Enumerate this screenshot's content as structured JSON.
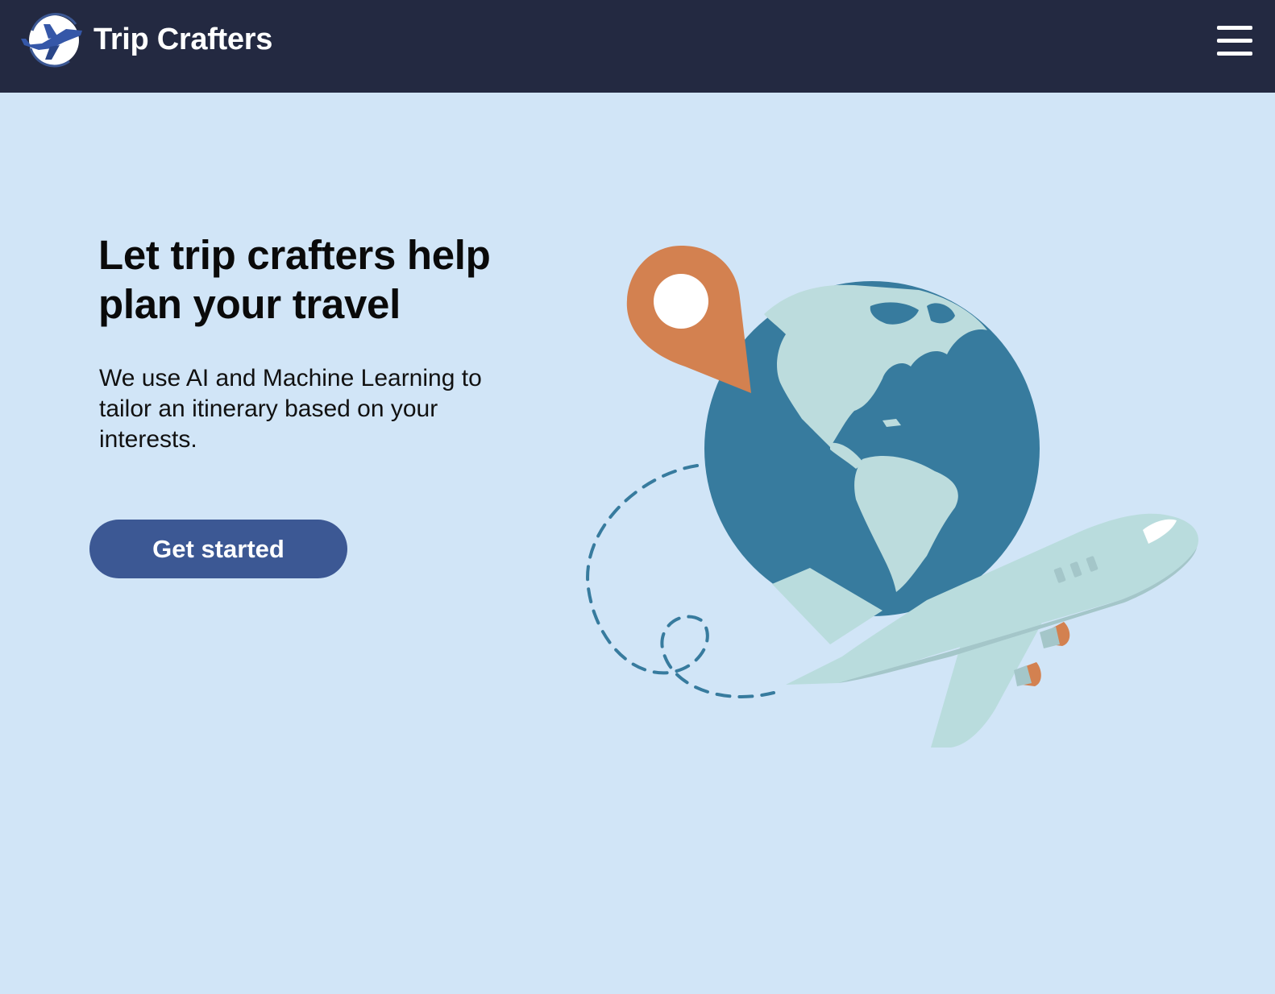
{
  "brand": {
    "name": "Trip Crafters",
    "logo_icon": "plane-globe-logo-icon"
  },
  "header": {
    "menu_icon": "hamburger-menu-icon"
  },
  "hero": {
    "title": "Let trip crafters help plan your travel",
    "description": "We use AI and Machine Learning to tailor an itinerary based on your interests.",
    "cta_label": "Get started"
  },
  "illustration": {
    "elements": [
      "location-pin-icon",
      "globe-icon",
      "airplane-icon",
      "dashed-flight-path"
    ]
  },
  "colors": {
    "navbar": "#232941",
    "page_background": "#d1e5f7",
    "button": "#3c5894",
    "ocean": "#377b9e",
    "land": "#bcdcdd",
    "pin": "#d38150",
    "plane": "#b9dcdd"
  }
}
